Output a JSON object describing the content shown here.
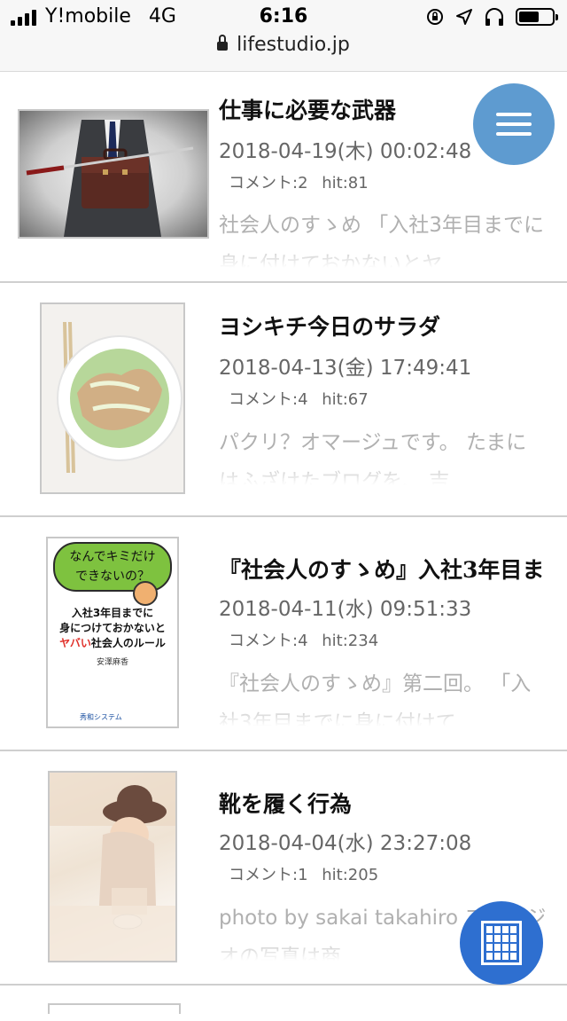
{
  "status_bar": {
    "carrier": "Y!mobile",
    "network": "4G",
    "time": "6:16"
  },
  "address_bar": {
    "domain": "lifestudio.jp"
  },
  "icons": {
    "menu": "hamburger-menu-icon",
    "grid": "calendar-grid-icon",
    "lock": "lock-icon"
  },
  "colors": {
    "menu_button": "#5e9bd0",
    "grid_button": "#2e6fd0",
    "text_muted": "#666666"
  },
  "articles": [
    {
      "title": "仕事に必要な武器",
      "date": "2018-04-19(木) 00:02:48",
      "comments": "コメント:2",
      "hits": "hit:81",
      "excerpt": "社会人のすゝめ 「入社3年目までに身に付けておかないとヤ"
    },
    {
      "title": "ヨシキチ今日のサラダ",
      "date": "2018-04-13(金) 17:49:41",
      "comments": "コメント:4",
      "hits": "hit:67",
      "excerpt": "パクリ？オマージュです。 たまにはふざけたブログを、 吉"
    },
    {
      "title": "『社会人のすゝめ』入社3年目ま",
      "date": "2018-04-11(水) 09:51:33",
      "comments": "コメント:4",
      "hits": "hit:234",
      "excerpt": "『社会人のすゝめ』第二回。 「入社3年目までに身に付けて",
      "book": {
        "bubble_line1": "なんでキミだけ",
        "bubble_line2": "できないの？",
        "line1": "入社3年目までに",
        "line2": "身につけておかないと",
        "line3_accent": "ヤバい",
        "line3_rest": "社会人のルール",
        "author": "安澤麻香",
        "publisher": "秀和システム"
      }
    },
    {
      "title": "靴を履く行為",
      "date": "2018-04-04(水) 23:27:08",
      "comments": "コメント:1",
      "hits": "hit:205",
      "excerpt": "photo by sakai takahiro フスタジオの写真は商"
    }
  ]
}
